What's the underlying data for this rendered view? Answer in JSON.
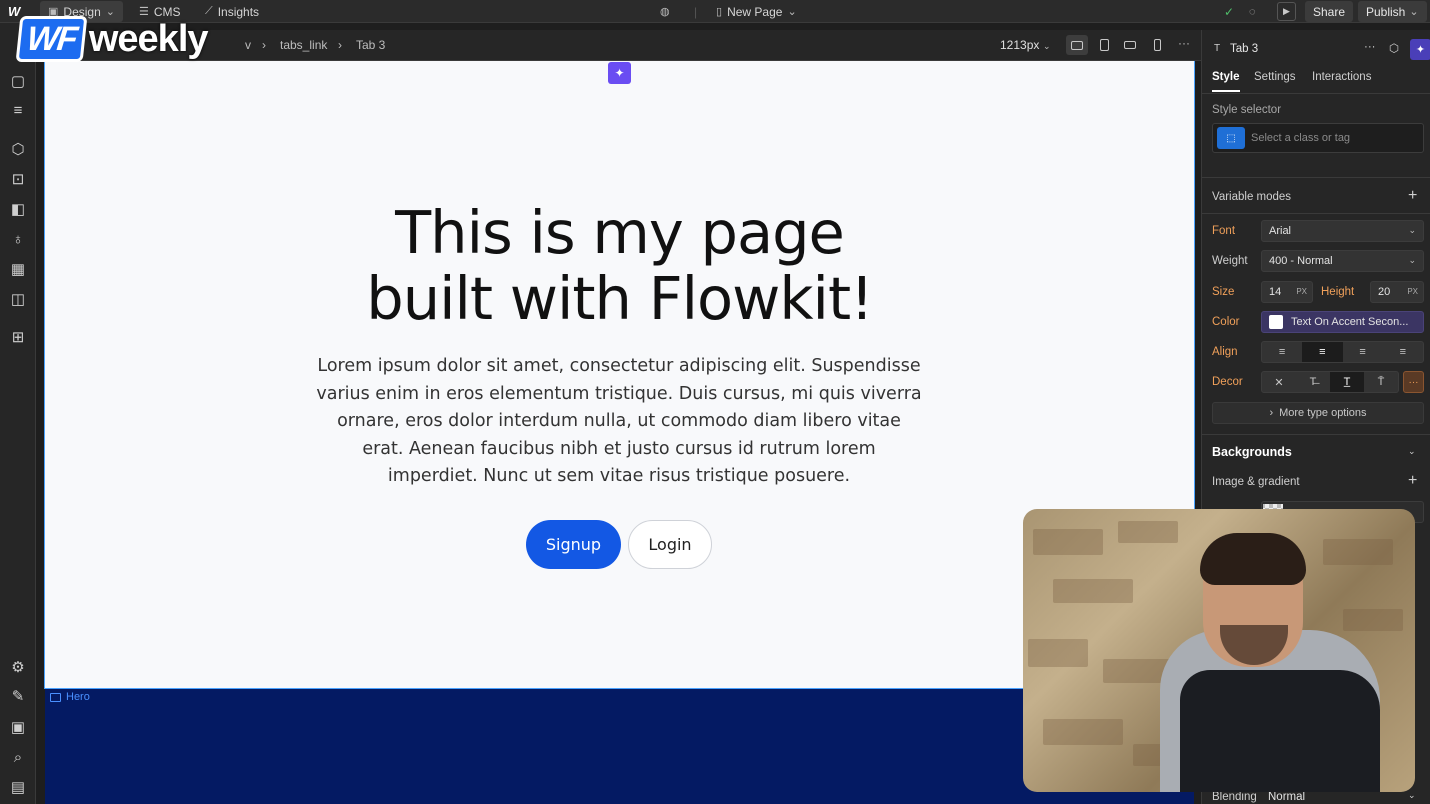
{
  "topbar": {
    "design_label": "Design",
    "cms_label": "CMS",
    "insights_label": "Insights",
    "page_label": "New Page",
    "share_label": "Share",
    "publish_label": "Publish"
  },
  "brand": {
    "wf": "WF",
    "weekly": "weekly"
  },
  "breadcrumb": {
    "items": [
      "v",
      "tabs_link",
      "Tab 3"
    ],
    "width_label": "1213px"
  },
  "canvas": {
    "title_line1": "This is my page",
    "title_line2": "built with Flowkit!",
    "body": "Lorem ipsum dolor sit amet, consectetur adipiscing elit. Suspendisse varius enim in eros elementum tristique. Duis cursus, mi quis viverra ornare, eros dolor interdum nulla, ut commodo diam libero vitae erat. Aenean faucibus nibh et justo cursus id rutrum lorem imperdiet. Nunc ut sem vitae risus tristique posuere.",
    "signup_label": "Signup",
    "login_label": "Login",
    "section_tag": "Hero"
  },
  "panel": {
    "element_name": "Tab 3",
    "tabs": [
      "Style",
      "Settings",
      "Interactions"
    ],
    "style_selector_label": "Style selector",
    "selector_placeholder": "Select a class or tag",
    "variable_modes_label": "Variable modes",
    "font_label": "Font",
    "font_value": "Arial",
    "weight_label": "Weight",
    "weight_value": "400 - Normal",
    "size_label": "Size",
    "size_value": "14",
    "size_unit": "PX",
    "height_label": "Height",
    "height_value": "20",
    "height_unit": "PX",
    "color_label": "Color",
    "color_value": "Text On Accent Secon...",
    "align_label": "Align",
    "decor_label": "Decor",
    "more_type_label": "More type options",
    "backgrounds_label": "Backgrounds",
    "image_gradient_label": "Image & gradient",
    "blending_label": "Blending",
    "blending_value": "Normal"
  },
  "colors": {
    "accent_blue": "#1358e4",
    "canvas_bg": "#f8f9fb",
    "dark_section": "#041a63",
    "ai_purple": "#6a4df2",
    "label_orange": "#f0a05a"
  }
}
